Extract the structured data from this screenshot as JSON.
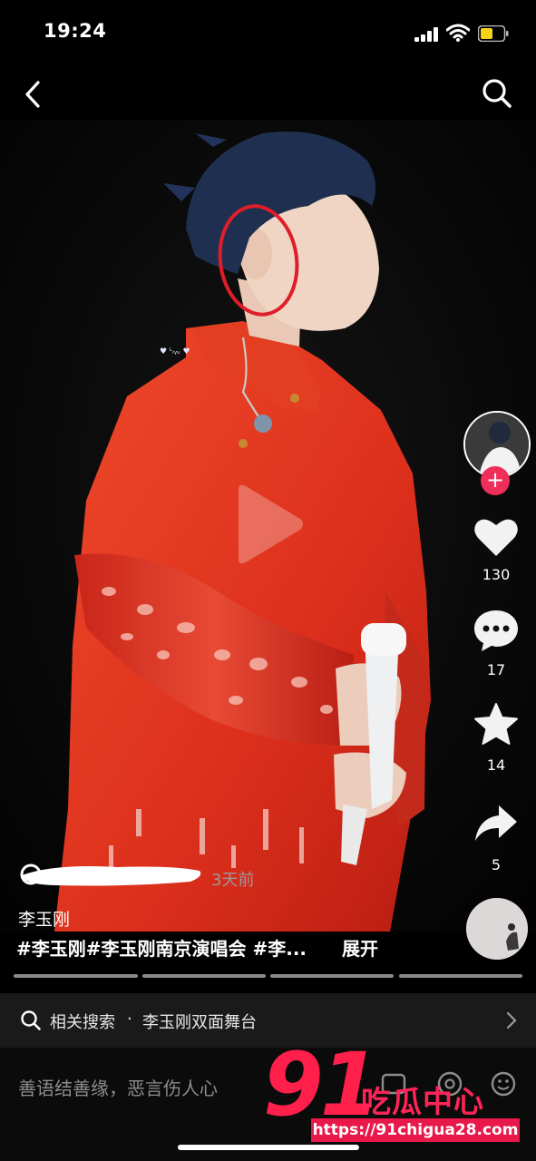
{
  "status_bar": {
    "time": "19:24",
    "icons": [
      "signal-icon",
      "wifi-icon",
      "battery-icon"
    ]
  },
  "nav": {
    "back_icon": "chevron-left-icon",
    "search_icon": "search-icon"
  },
  "video": {
    "play_icon": "play-icon"
  },
  "actions": {
    "follow_label": "+",
    "like_count": "130",
    "comment_count": "17",
    "favorite_count": "14",
    "share_count": "5"
  },
  "post": {
    "time_ago": "3天前",
    "author": "李玉刚",
    "hashtags": "#李玉刚#李玉刚南京演唱会 #李...",
    "expand_label": "展开"
  },
  "related_search": {
    "prefix": "相关搜索",
    "separator": "·",
    "term": "李玉刚双面舞台"
  },
  "comment_bar": {
    "placeholder": "善语结善缘，恶言伤人心"
  },
  "watermark": {
    "number": "91",
    "name": "吃瓜中心",
    "url": "https://91chigua28.com"
  },
  "colors": {
    "accent": "#ef2e5a",
    "watermark": "#ff1f4b",
    "robe": "#e8361f"
  }
}
